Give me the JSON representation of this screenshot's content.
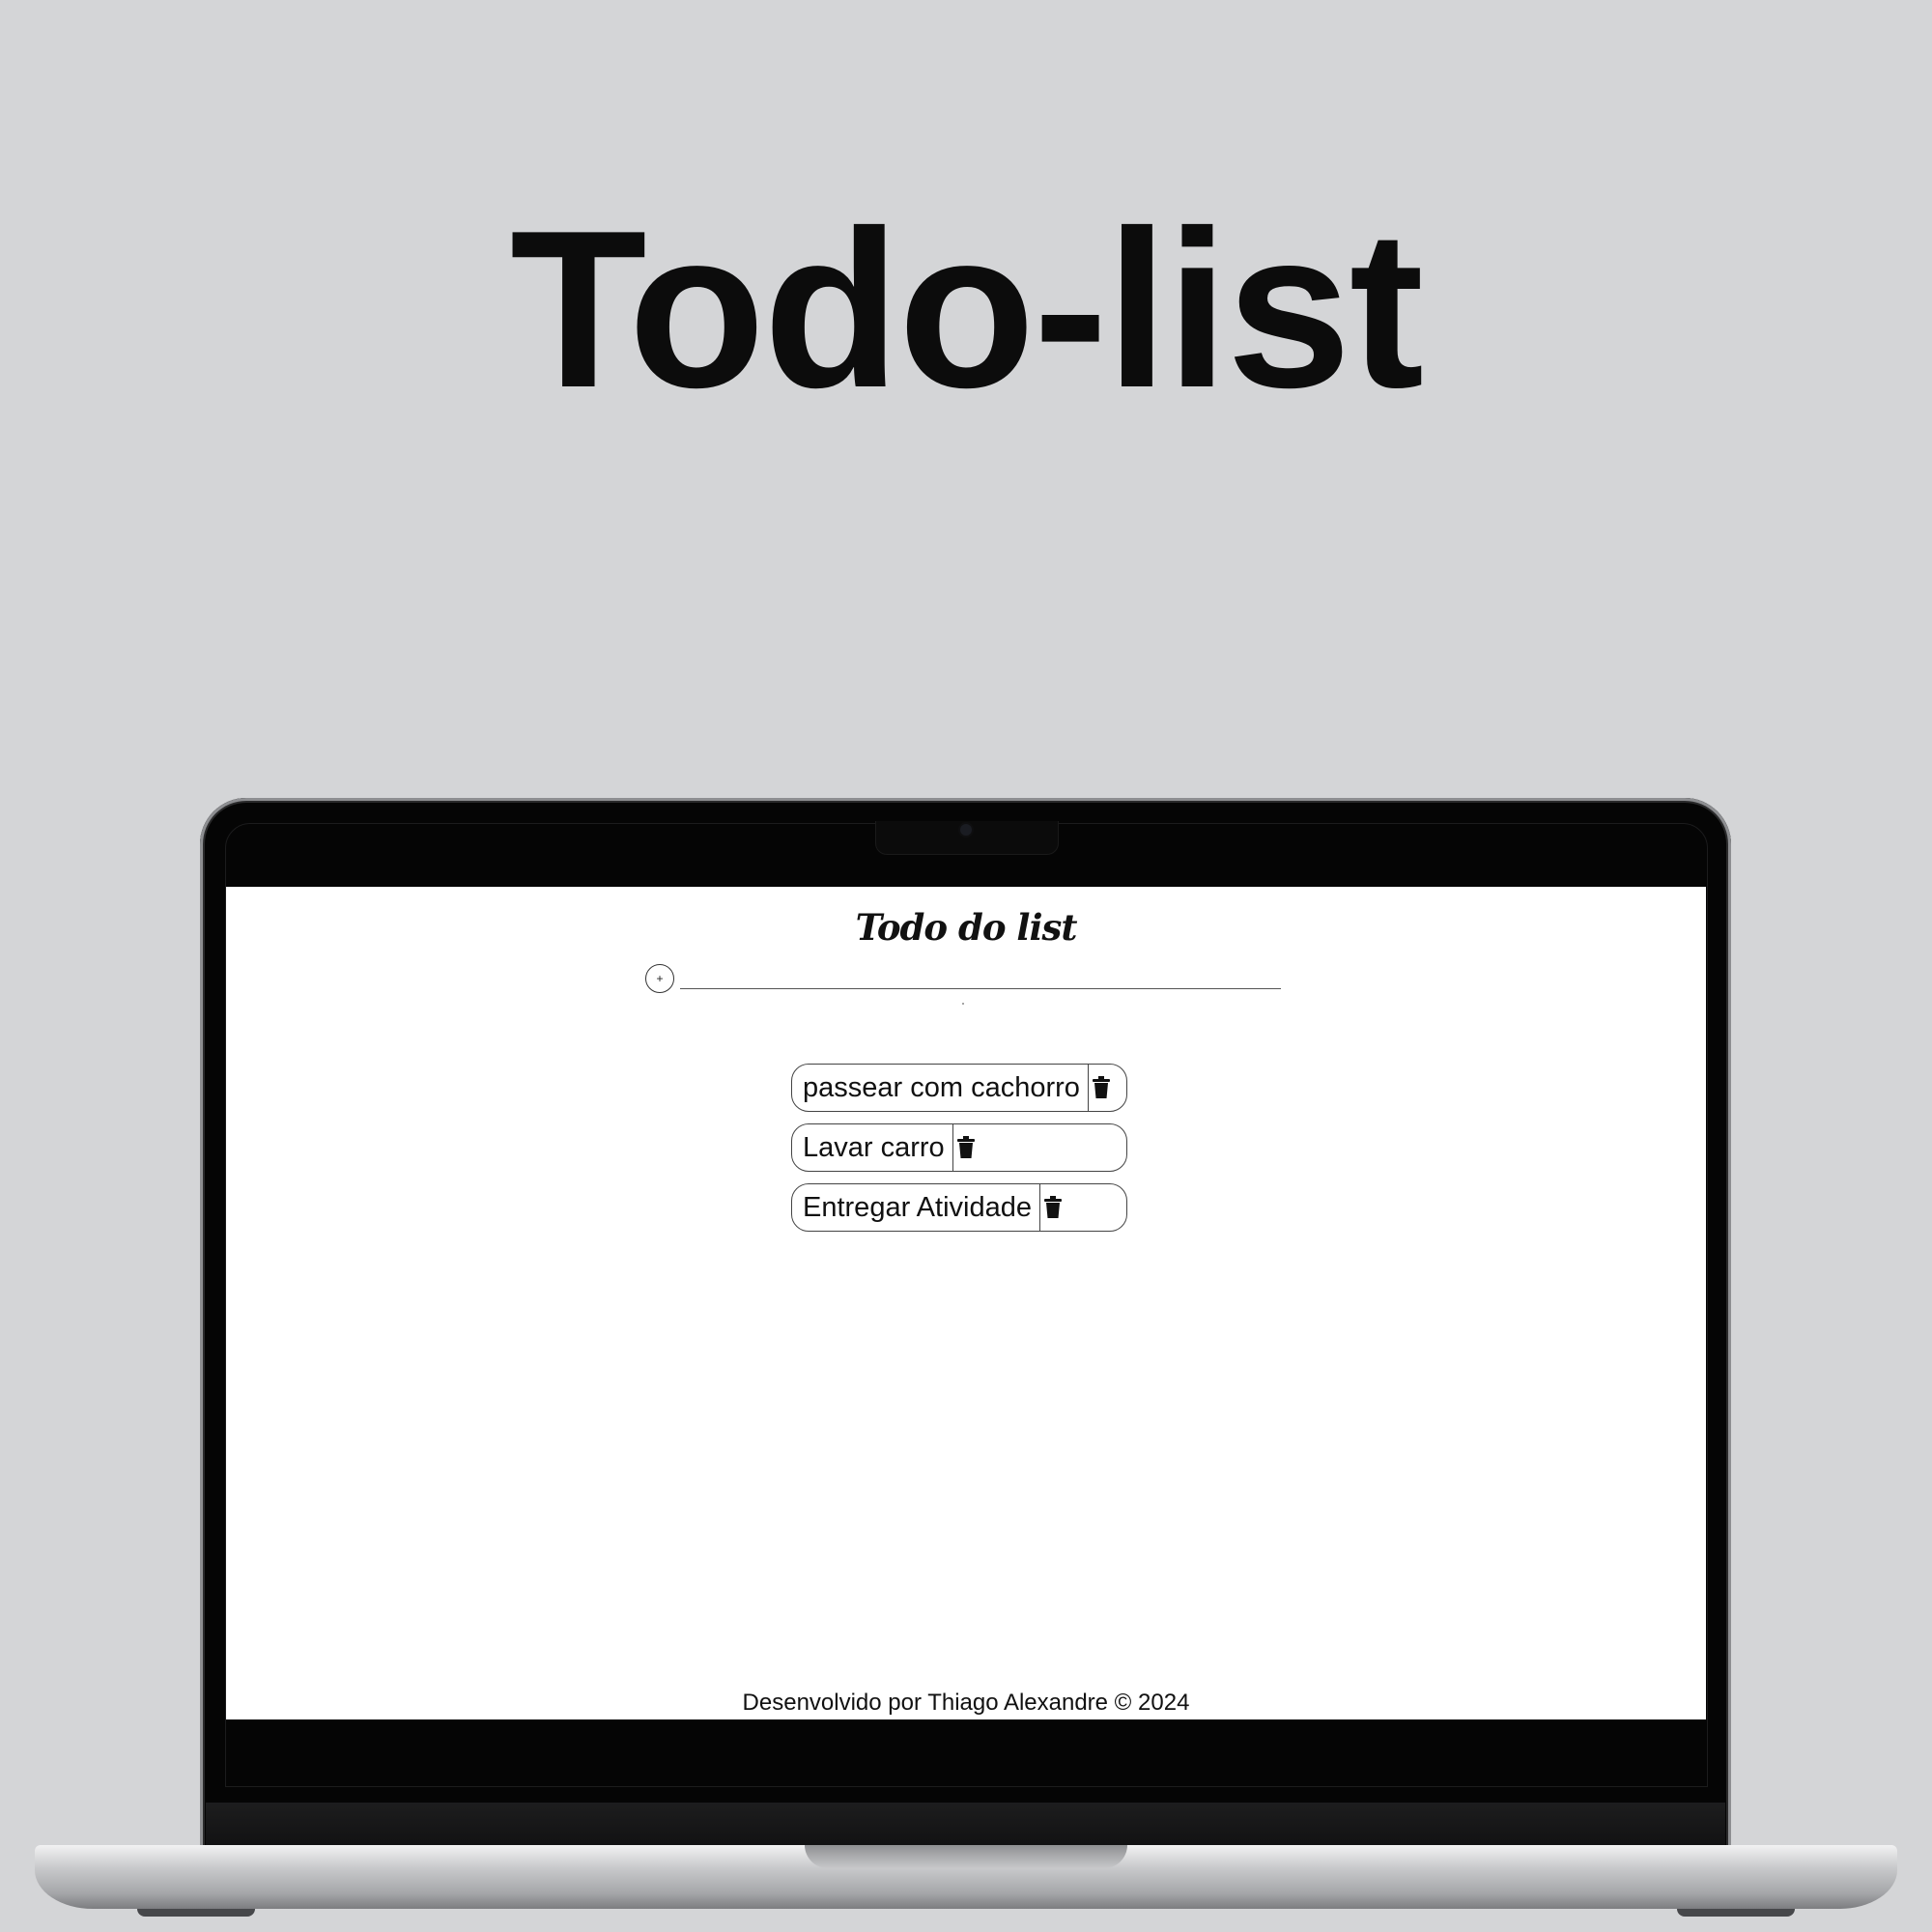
{
  "headline": "Todo-list",
  "app": {
    "title": "Todo do list",
    "add_button": {
      "symbol": "+",
      "icon": "plus-circle-icon"
    },
    "input": {
      "value": "",
      "placeholder": ""
    },
    "todos": [
      {
        "text": "passear com cachorro",
        "delete_icon": "trash-icon"
      },
      {
        "text": "Lavar carro",
        "delete_icon": "trash-icon"
      },
      {
        "text": "Entregar Atividade",
        "delete_icon": "trash-icon"
      }
    ],
    "footer": "Desenvolvido por Thiago Alexandre © 2024"
  },
  "colors": {
    "background": "#d4d5d7",
    "headline": "#0c0c0c",
    "screen": "#ffffff",
    "laptop_bezel": "#050505"
  }
}
